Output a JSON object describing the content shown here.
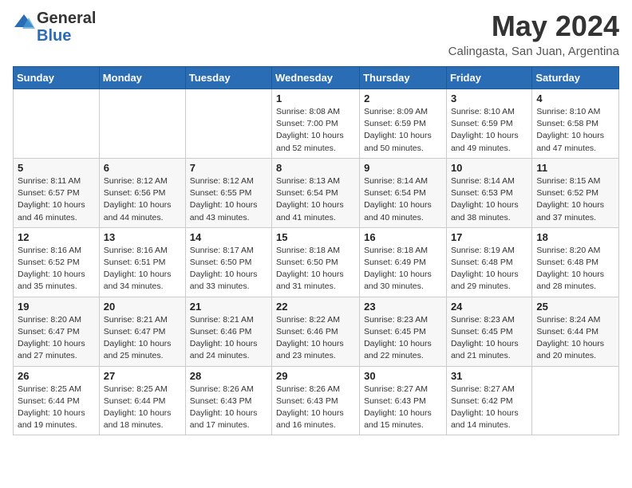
{
  "logo": {
    "general": "General",
    "blue": "Blue"
  },
  "title": "May 2024",
  "subtitle": "Calingasta, San Juan, Argentina",
  "days_of_week": [
    "Sunday",
    "Monday",
    "Tuesday",
    "Wednesday",
    "Thursday",
    "Friday",
    "Saturday"
  ],
  "weeks": [
    [
      {
        "day": "",
        "info": ""
      },
      {
        "day": "",
        "info": ""
      },
      {
        "day": "",
        "info": ""
      },
      {
        "day": "1",
        "info": "Sunrise: 8:08 AM\nSunset: 7:00 PM\nDaylight: 10 hours\nand 52 minutes."
      },
      {
        "day": "2",
        "info": "Sunrise: 8:09 AM\nSunset: 6:59 PM\nDaylight: 10 hours\nand 50 minutes."
      },
      {
        "day": "3",
        "info": "Sunrise: 8:10 AM\nSunset: 6:59 PM\nDaylight: 10 hours\nand 49 minutes."
      },
      {
        "day": "4",
        "info": "Sunrise: 8:10 AM\nSunset: 6:58 PM\nDaylight: 10 hours\nand 47 minutes."
      }
    ],
    [
      {
        "day": "5",
        "info": "Sunrise: 8:11 AM\nSunset: 6:57 PM\nDaylight: 10 hours\nand 46 minutes."
      },
      {
        "day": "6",
        "info": "Sunrise: 8:12 AM\nSunset: 6:56 PM\nDaylight: 10 hours\nand 44 minutes."
      },
      {
        "day": "7",
        "info": "Sunrise: 8:12 AM\nSunset: 6:55 PM\nDaylight: 10 hours\nand 43 minutes."
      },
      {
        "day": "8",
        "info": "Sunrise: 8:13 AM\nSunset: 6:54 PM\nDaylight: 10 hours\nand 41 minutes."
      },
      {
        "day": "9",
        "info": "Sunrise: 8:14 AM\nSunset: 6:54 PM\nDaylight: 10 hours\nand 40 minutes."
      },
      {
        "day": "10",
        "info": "Sunrise: 8:14 AM\nSunset: 6:53 PM\nDaylight: 10 hours\nand 38 minutes."
      },
      {
        "day": "11",
        "info": "Sunrise: 8:15 AM\nSunset: 6:52 PM\nDaylight: 10 hours\nand 37 minutes."
      }
    ],
    [
      {
        "day": "12",
        "info": "Sunrise: 8:16 AM\nSunset: 6:52 PM\nDaylight: 10 hours\nand 35 minutes."
      },
      {
        "day": "13",
        "info": "Sunrise: 8:16 AM\nSunset: 6:51 PM\nDaylight: 10 hours\nand 34 minutes."
      },
      {
        "day": "14",
        "info": "Sunrise: 8:17 AM\nSunset: 6:50 PM\nDaylight: 10 hours\nand 33 minutes."
      },
      {
        "day": "15",
        "info": "Sunrise: 8:18 AM\nSunset: 6:50 PM\nDaylight: 10 hours\nand 31 minutes."
      },
      {
        "day": "16",
        "info": "Sunrise: 8:18 AM\nSunset: 6:49 PM\nDaylight: 10 hours\nand 30 minutes."
      },
      {
        "day": "17",
        "info": "Sunrise: 8:19 AM\nSunset: 6:48 PM\nDaylight: 10 hours\nand 29 minutes."
      },
      {
        "day": "18",
        "info": "Sunrise: 8:20 AM\nSunset: 6:48 PM\nDaylight: 10 hours\nand 28 minutes."
      }
    ],
    [
      {
        "day": "19",
        "info": "Sunrise: 8:20 AM\nSunset: 6:47 PM\nDaylight: 10 hours\nand 27 minutes."
      },
      {
        "day": "20",
        "info": "Sunrise: 8:21 AM\nSunset: 6:47 PM\nDaylight: 10 hours\nand 25 minutes."
      },
      {
        "day": "21",
        "info": "Sunrise: 8:21 AM\nSunset: 6:46 PM\nDaylight: 10 hours\nand 24 minutes."
      },
      {
        "day": "22",
        "info": "Sunrise: 8:22 AM\nSunset: 6:46 PM\nDaylight: 10 hours\nand 23 minutes."
      },
      {
        "day": "23",
        "info": "Sunrise: 8:23 AM\nSunset: 6:45 PM\nDaylight: 10 hours\nand 22 minutes."
      },
      {
        "day": "24",
        "info": "Sunrise: 8:23 AM\nSunset: 6:45 PM\nDaylight: 10 hours\nand 21 minutes."
      },
      {
        "day": "25",
        "info": "Sunrise: 8:24 AM\nSunset: 6:44 PM\nDaylight: 10 hours\nand 20 minutes."
      }
    ],
    [
      {
        "day": "26",
        "info": "Sunrise: 8:25 AM\nSunset: 6:44 PM\nDaylight: 10 hours\nand 19 minutes."
      },
      {
        "day": "27",
        "info": "Sunrise: 8:25 AM\nSunset: 6:44 PM\nDaylight: 10 hours\nand 18 minutes."
      },
      {
        "day": "28",
        "info": "Sunrise: 8:26 AM\nSunset: 6:43 PM\nDaylight: 10 hours\nand 17 minutes."
      },
      {
        "day": "29",
        "info": "Sunrise: 8:26 AM\nSunset: 6:43 PM\nDaylight: 10 hours\nand 16 minutes."
      },
      {
        "day": "30",
        "info": "Sunrise: 8:27 AM\nSunset: 6:43 PM\nDaylight: 10 hours\nand 15 minutes."
      },
      {
        "day": "31",
        "info": "Sunrise: 8:27 AM\nSunset: 6:42 PM\nDaylight: 10 hours\nand 14 minutes."
      },
      {
        "day": "",
        "info": ""
      }
    ]
  ]
}
